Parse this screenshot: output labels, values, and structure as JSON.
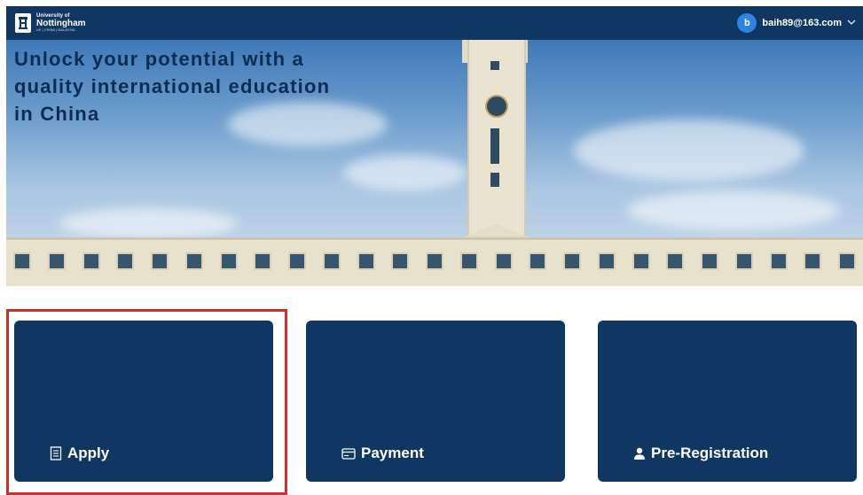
{
  "header": {
    "logo": {
      "line1": "University of",
      "line2": "Nottingham",
      "line3": "UK | CHINA | MALAYSIA"
    },
    "user": {
      "avatar_initial": "b",
      "email": "baih89@163.com",
      "dropdown_icon": "chevron-down-icon"
    }
  },
  "hero": {
    "title": "Unlock your potential with a quality international education in China"
  },
  "cards": [
    {
      "label": "Apply",
      "icon": "document-icon"
    },
    {
      "label": "Payment",
      "icon": "credit-card-icon"
    },
    {
      "label": "Pre-Registration",
      "icon": "person-icon"
    }
  ],
  "colors": {
    "brand_navy": "#0f3761",
    "avatar_blue": "#2b84e4",
    "highlight_red": "#d62b2b",
    "hero_title": "#0d2c52"
  }
}
